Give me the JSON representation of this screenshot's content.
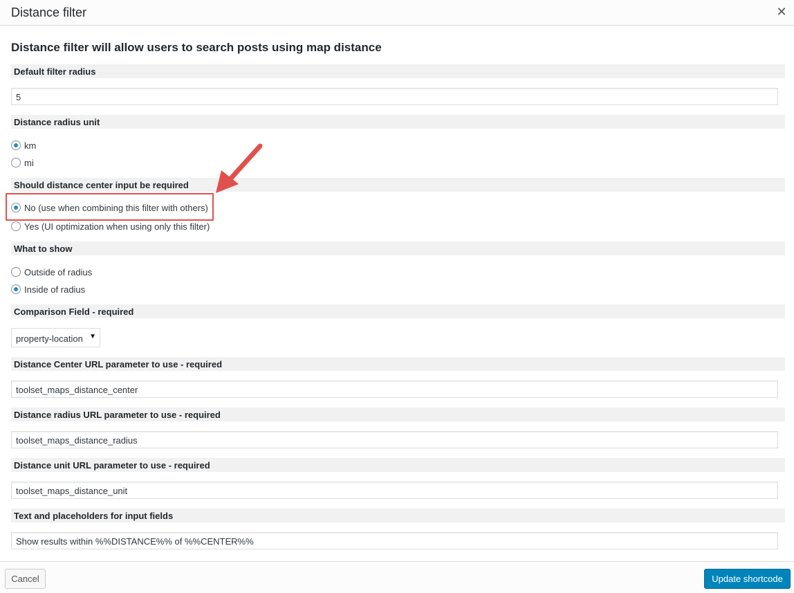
{
  "dialog": {
    "title": "Distance filter",
    "close_icon": "close-icon",
    "heading": "Distance filter will allow users to search posts using map distance"
  },
  "sections": {
    "default_radius": {
      "label": "Default filter radius",
      "value": "5"
    },
    "radius_unit": {
      "label": "Distance radius unit",
      "options": [
        {
          "label": "km",
          "checked": true
        },
        {
          "label": "mi",
          "checked": false
        }
      ]
    },
    "center_required": {
      "label": "Should distance center input be required",
      "options": [
        {
          "label": "No (use when combining this filter with others)",
          "checked": true
        },
        {
          "label": "Yes (UI optimization when using only this filter)",
          "checked": false
        }
      ]
    },
    "what_to_show": {
      "label": "What to show",
      "options": [
        {
          "label": "Outside of radius",
          "checked": false
        },
        {
          "label": "Inside of radius",
          "checked": true
        }
      ]
    },
    "comparison_field": {
      "label": "Comparison Field - required",
      "selected": "property-location"
    },
    "center_param": {
      "label": "Distance Center URL parameter to use - required",
      "value": "toolset_maps_distance_center"
    },
    "radius_param": {
      "label": "Distance radius URL parameter to use - required",
      "value": "toolset_maps_distance_radius"
    },
    "unit_param": {
      "label": "Distance unit URL parameter to use - required",
      "value": "toolset_maps_distance_unit"
    },
    "placeholders": {
      "label": "Text and placeholders for input fields",
      "value": "Show results within %%DISTANCE%% of %%CENTER%%"
    }
  },
  "footer": {
    "cancel_label": "Cancel",
    "update_label": "Update shortcode"
  },
  "colors": {
    "accent": "#0085ba",
    "radio_dot": "#1e8cbe",
    "annotation": "#e0514e"
  }
}
